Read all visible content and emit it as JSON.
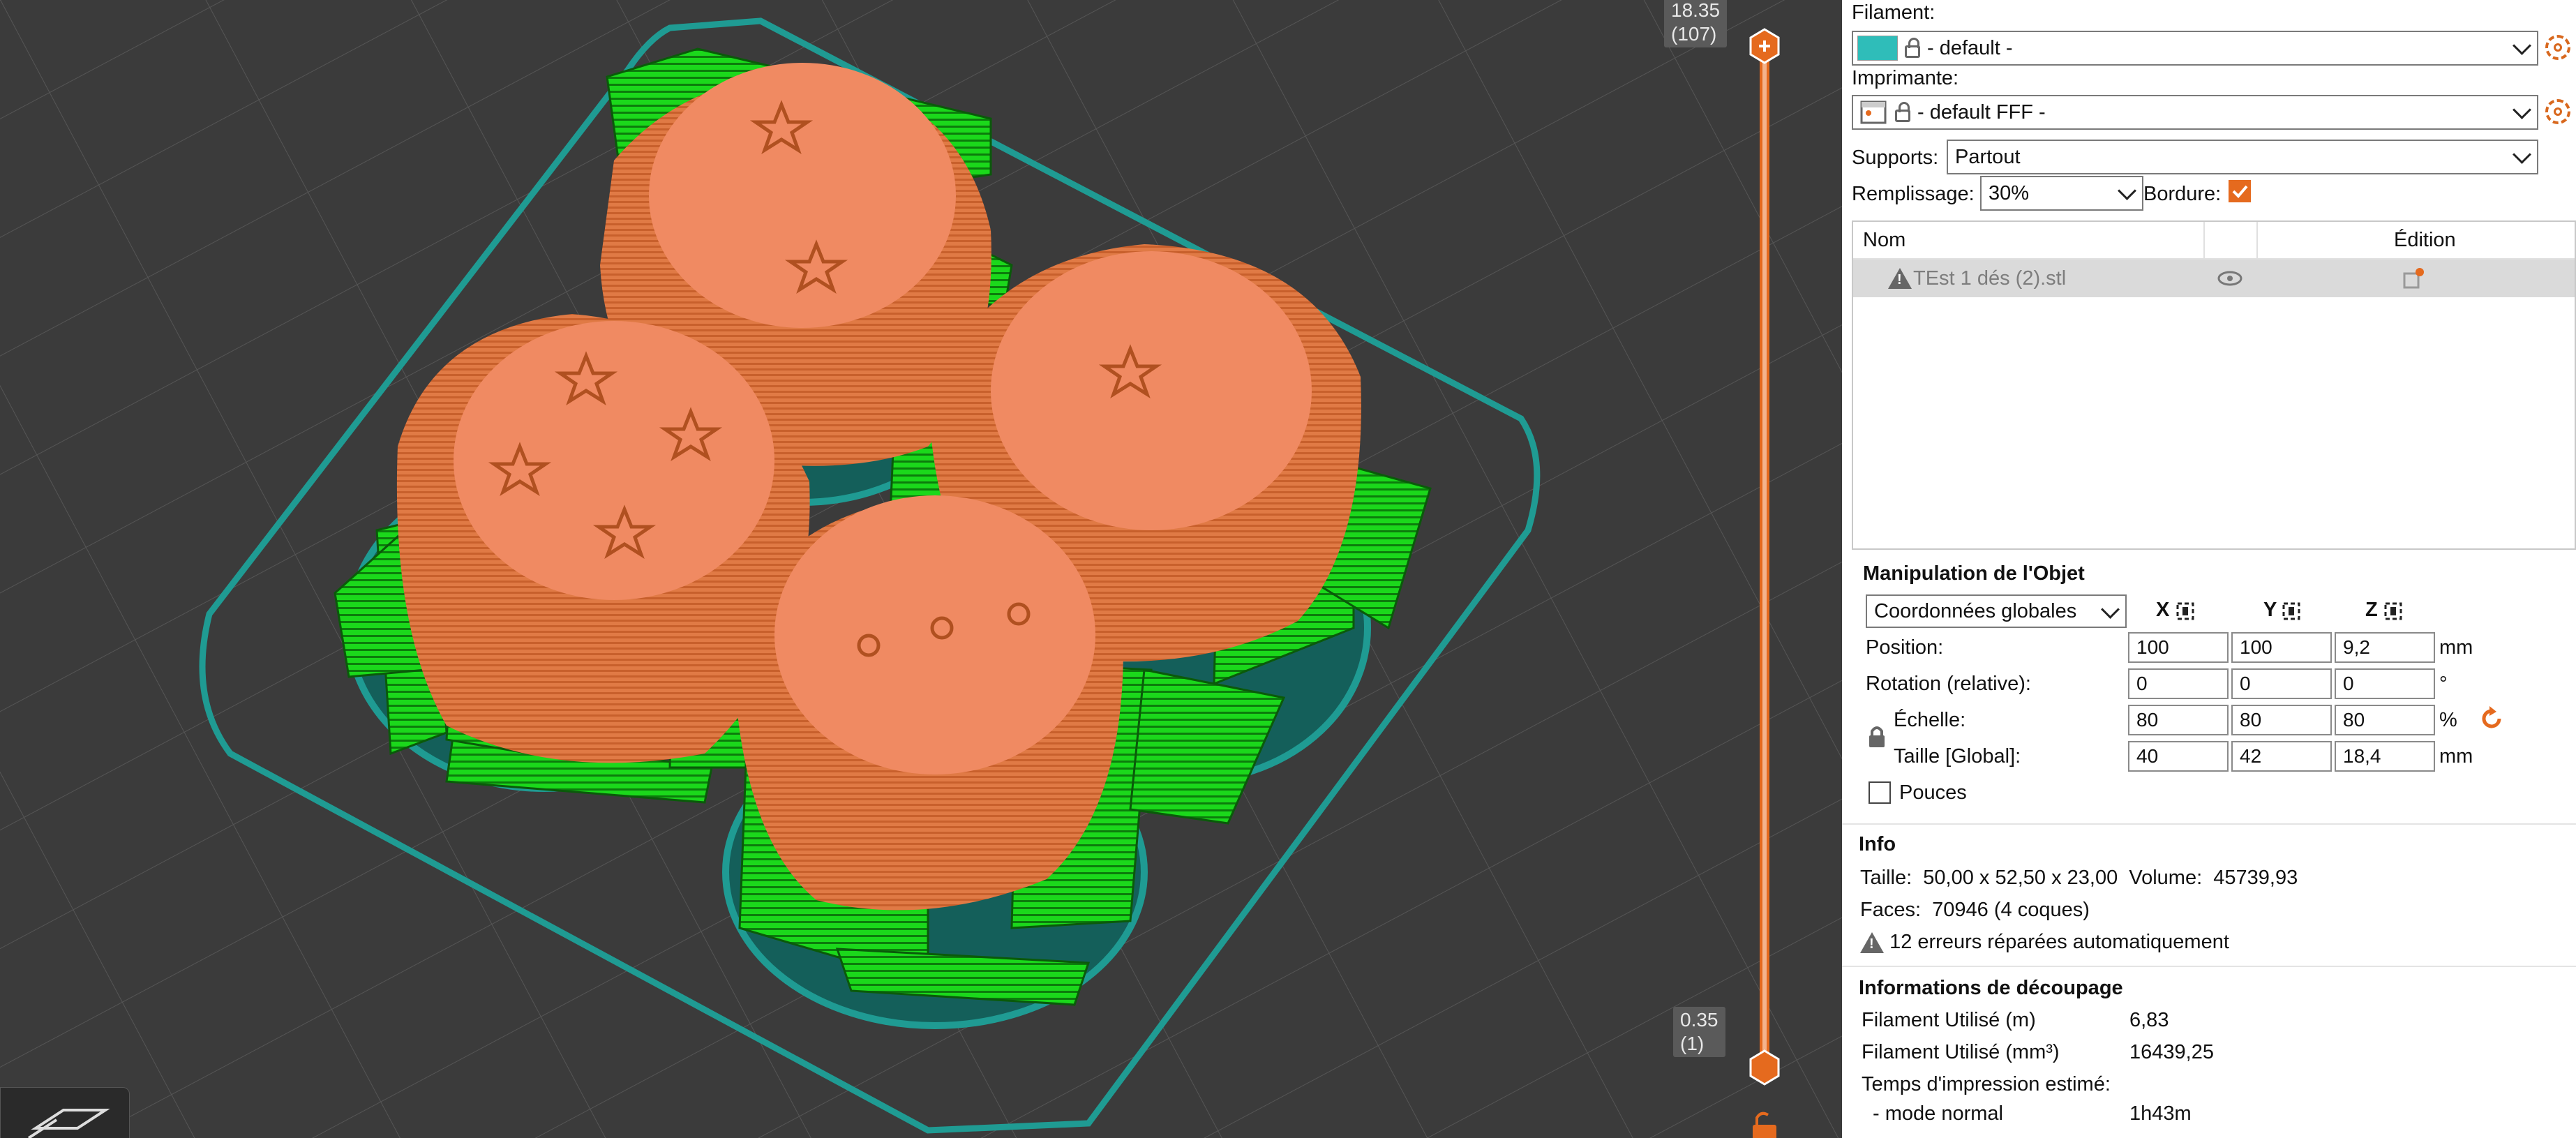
{
  "slider": {
    "top_value": "18.35",
    "top_layer": "(107)",
    "bottom_value": "0.35",
    "bottom_layer": "(1)"
  },
  "panel": {
    "filament_label": "Filament:",
    "filament_value": "- default -",
    "filament_color": "#2fbdb9",
    "printer_label": "Imprimante:",
    "printer_value": "- default FFF -",
    "supports_label": "Supports:",
    "supports_value": "Partout",
    "infill_label": "Remplissage:",
    "infill_value": "30%",
    "brim_label": "Bordure:",
    "brim_checked": true,
    "object_list": {
      "col_name": "Nom",
      "col_edit": "Édition",
      "items": [
        {
          "name": "TEst 1 dés (2).stl",
          "visible_icon": "eye-icon",
          "edit_icon": "edit-settings-icon"
        }
      ]
    },
    "manipulation": {
      "title": "Manipulation de l'Objet",
      "coord_system": "Coordonnées globales",
      "axis_x": "X",
      "axis_y": "Y",
      "axis_z": "Z",
      "position_label": "Position:",
      "position": [
        "100",
        "100",
        "9,2"
      ],
      "position_unit": "mm",
      "rotation_label": "Rotation (relative):",
      "rotation": [
        "0",
        "0",
        "0"
      ],
      "rotation_unit": "°",
      "scale_label": "Échelle:",
      "scale": [
        "80",
        "80",
        "80"
      ],
      "scale_unit": "%",
      "size_label": "Taille [Global]:",
      "size": [
        "40",
        "42",
        "18,4"
      ],
      "size_unit": "mm",
      "inches_label": "Pouces",
      "inches_checked": false
    },
    "info": {
      "title": "Info",
      "size_label": "Taille:",
      "size_value": "50,00 x 52,50 x 23,00",
      "volume_label": "Volume:",
      "volume_value": "45739,93",
      "faces_label": "Faces:",
      "faces_value": "70946 (4 coques)",
      "errors_text": "12 erreurs réparées automatiquement"
    },
    "slicing": {
      "title": "Informations de découpage",
      "filament_m_label": "Filament Utilisé (m)",
      "filament_m_value": "6,83",
      "filament_mm3_label": "Filament Utilisé (mm³)",
      "filament_mm3_value": "16439,25",
      "print_time_label": "Temps d'impression estimé:",
      "normal_mode_label": "- mode normal",
      "normal_mode_value": "1h43m"
    }
  },
  "colors": {
    "accent": "#e56a1e",
    "support_green": "#19e619",
    "object_orange": "#e07a45",
    "skirt_teal": "#1f9b93"
  }
}
